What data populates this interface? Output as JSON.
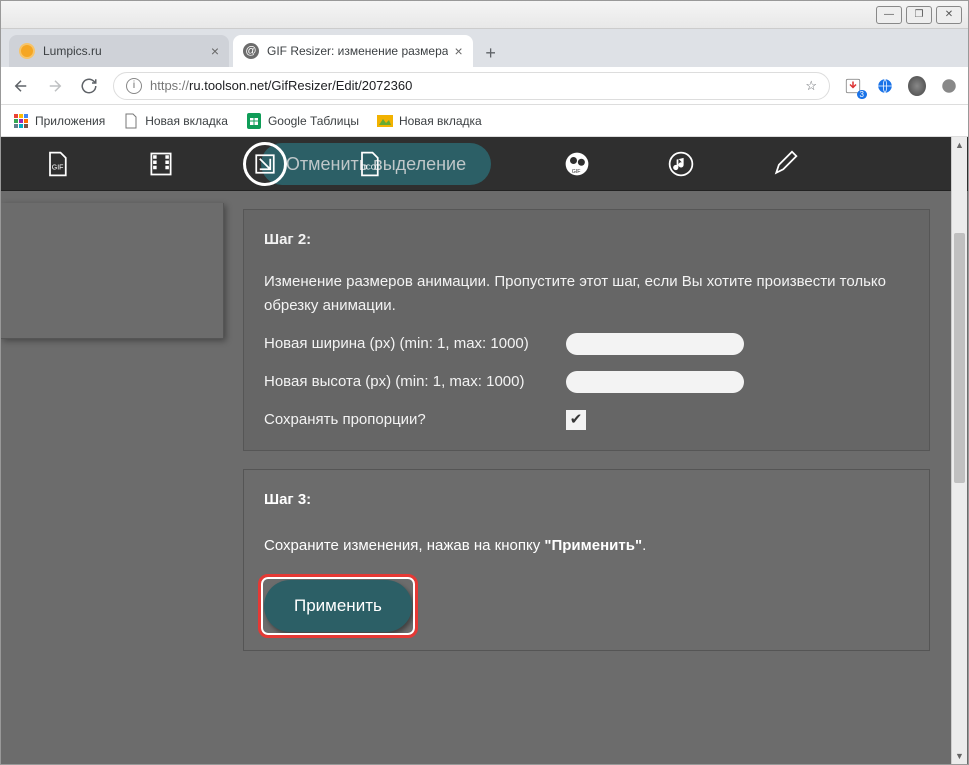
{
  "window": {
    "min": "—",
    "max": "❐",
    "close": "✕"
  },
  "tabs": [
    {
      "title": "Lumpics.ru",
      "favicon_color": "#f5a623",
      "active": false
    },
    {
      "title": "GIF Resizer: изменение размера",
      "favicon_color": "#6c6c6c",
      "active": true
    }
  ],
  "new_tab": "+",
  "nav": {
    "back": "←",
    "forward": "→",
    "reload": "↻"
  },
  "url": {
    "protocol": "https://",
    "rest": "ru.toolson.net/GifResizer/Edit/2072360",
    "star": "☆"
  },
  "ext": {
    "idm_badge": "3"
  },
  "bookmarks": [
    {
      "label": "Приложения",
      "icon": "apps"
    },
    {
      "label": "Новая вкладка",
      "icon": "doc"
    },
    {
      "label": "Google Таблицы",
      "icon": "sheets"
    },
    {
      "label": "Новая вкладка",
      "icon": "image"
    }
  ],
  "top_pill": "Отменить выделение",
  "step2": {
    "title": "Шаг 2:",
    "desc": "Изменение размеров анимации. Пропустите этот шаг, если Вы хотите произвести только обрезку анимации.",
    "width_label": "Новая ширина (px) (min: 1, max: 1000)",
    "height_label": "Новая высота (px) (min: 1, max: 1000)",
    "keep_ratio_label": "Сохранять пропорции?",
    "keep_ratio_checked": true
  },
  "step3": {
    "title": "Шаг 3:",
    "desc_pre": "Сохраните изменения, нажав на кнопку ",
    "desc_bold": "\"Применить\"",
    "desc_post": ".",
    "apply_label": "Применить"
  }
}
